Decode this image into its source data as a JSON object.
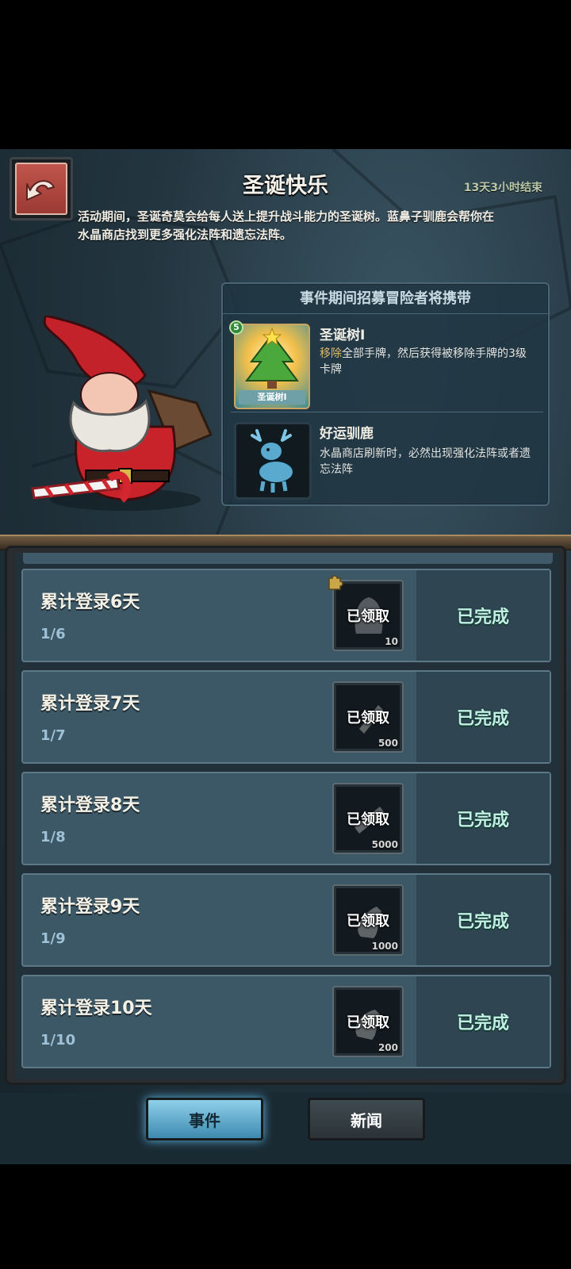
{
  "header": {
    "title": "圣诞快乐",
    "countdown": "13天3小时结束",
    "description": "活动期间，圣诞奇莫会给每人送上提升战斗能力的圣诞树。蓝鼻子驯鹿会帮你在水晶商店找到更多强化法阵和遗忘法阵。"
  },
  "carry_panel": {
    "header": "事件期间招募冒险者将携带",
    "items": [
      {
        "name": "圣诞树I",
        "card_label": "圣诞树I",
        "badge": "5",
        "desc_highlight": "移除",
        "desc_rest": "全部手牌，然后获得被移除手牌的3级卡牌"
      },
      {
        "name": "好运驯鹿",
        "desc": "水晶商店刷新时，必然出现强化法阵或者遗忘法阵"
      }
    ]
  },
  "tasks": [
    {
      "title": "累计登录6天",
      "progress": "1/6",
      "reward_status": "已领取",
      "reward_count": "10",
      "status": "已完成"
    },
    {
      "title": "累计登录7天",
      "progress": "1/7",
      "reward_status": "已领取",
      "reward_count": "500",
      "status": "已完成"
    },
    {
      "title": "累计登录8天",
      "progress": "1/8",
      "reward_status": "已领取",
      "reward_count": "5000",
      "status": "已完成"
    },
    {
      "title": "累计登录9天",
      "progress": "1/9",
      "reward_status": "已领取",
      "reward_count": "1000",
      "status": "已完成"
    },
    {
      "title": "累计登录10天",
      "progress": "1/10",
      "reward_status": "已领取",
      "reward_count": "200",
      "status": "已完成"
    }
  ],
  "tabs": [
    {
      "label": "事件",
      "active": true
    },
    {
      "label": "新闻",
      "active": false
    }
  ],
  "colors": {
    "accent_done": "#bff0e2",
    "active_tab": "#5ab8e3",
    "back_button": "#c0554c"
  }
}
